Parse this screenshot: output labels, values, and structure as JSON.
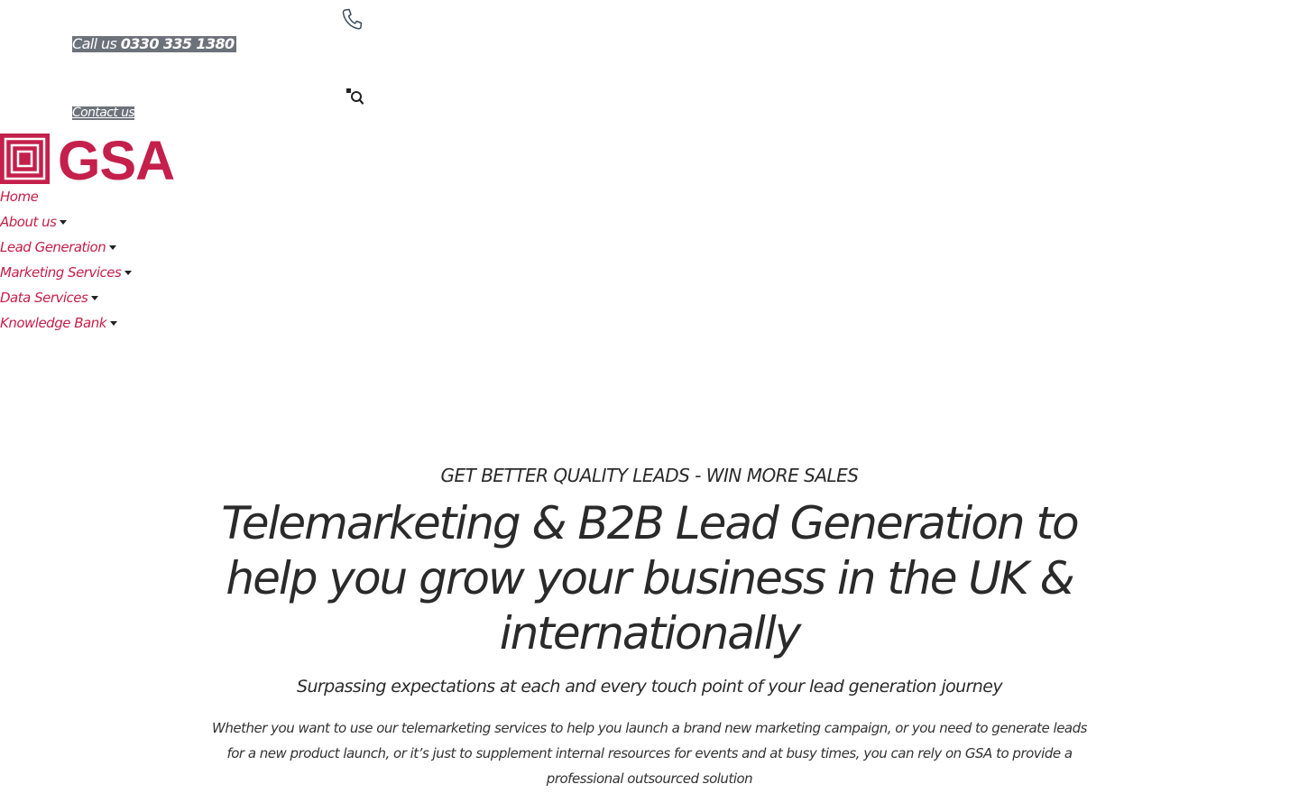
{
  "header": {
    "call": {
      "prefix": "Call us",
      "number": "0330 335 1380"
    },
    "contact_label": "Contact us",
    "icons": {
      "phone": "phone-icon",
      "search": "search-icon"
    }
  },
  "logo": {
    "text": "GSA",
    "color": "#c4204b",
    "icon": "concentric-squares-icon"
  },
  "nav": {
    "items": [
      {
        "label": "Home",
        "has_dropdown": false
      },
      {
        "label": "About us",
        "has_dropdown": true
      },
      {
        "label": "Lead Generation",
        "has_dropdown": true
      },
      {
        "label": "Marketing Services",
        "has_dropdown": true
      },
      {
        "label": "Data Services",
        "has_dropdown": true
      },
      {
        "label": "Knowledge Bank",
        "has_dropdown": true
      }
    ]
  },
  "hero": {
    "eyebrow": "GET BETTER QUALITY LEADS - WIN MORE SALES",
    "headline": "Telemarketing & B2B Lead Generation to help you grow your business in the UK & internationally",
    "subheadline": "Surpassing expectations at each and every touch point of your lead generation journey",
    "body": "Whether you want to use our telemarketing services to help you launch a brand new marketing campaign, or you need to generate leads for a new product launch, or it’s just to supplement internal resources for events and at busy times, you can rely on GSA to provide a professional outsourced solution"
  },
  "colors": {
    "brand": "#c4204b",
    "text": "#2a2a2a",
    "link_bg": "#6d727a"
  }
}
